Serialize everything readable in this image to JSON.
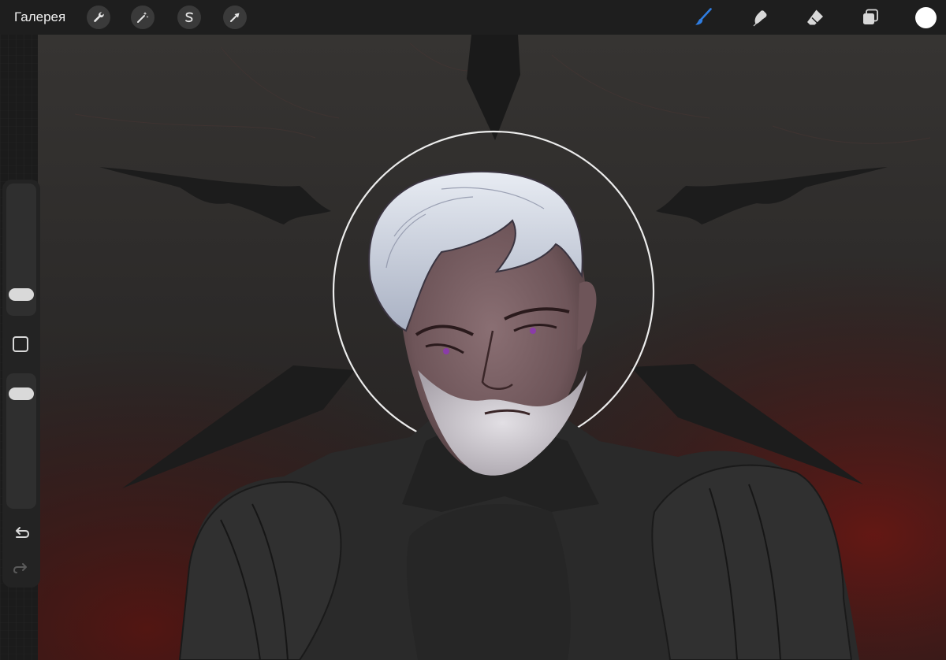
{
  "toolbar": {
    "gallery_label": "Галерея",
    "left_tools": [
      {
        "name": "actions",
        "icon": "wrench-icon"
      },
      {
        "name": "adjustments",
        "icon": "magic-wand-icon"
      },
      {
        "name": "selection",
        "icon": "selection-s-icon"
      },
      {
        "name": "transform",
        "icon": "arrow-cursor-icon"
      }
    ],
    "right_tools": [
      {
        "name": "brush",
        "icon": "brush-icon",
        "active": true
      },
      {
        "name": "smudge",
        "icon": "smudge-icon",
        "active": false
      },
      {
        "name": "eraser",
        "icon": "eraser-icon",
        "active": false
      },
      {
        "name": "layers",
        "icon": "layers-icon",
        "active": false
      }
    ],
    "current_color": "#ffffff",
    "active_tool_color": "#2f7de1"
  },
  "sidebar": {
    "brush_size_level": 0.75,
    "opacity_level": 0.15,
    "modify_button_icon": "square-icon",
    "undo_icon": "undo-icon",
    "redo_icon": "redo-icon"
  },
  "canvas": {
    "content": "artwork-portrait"
  }
}
